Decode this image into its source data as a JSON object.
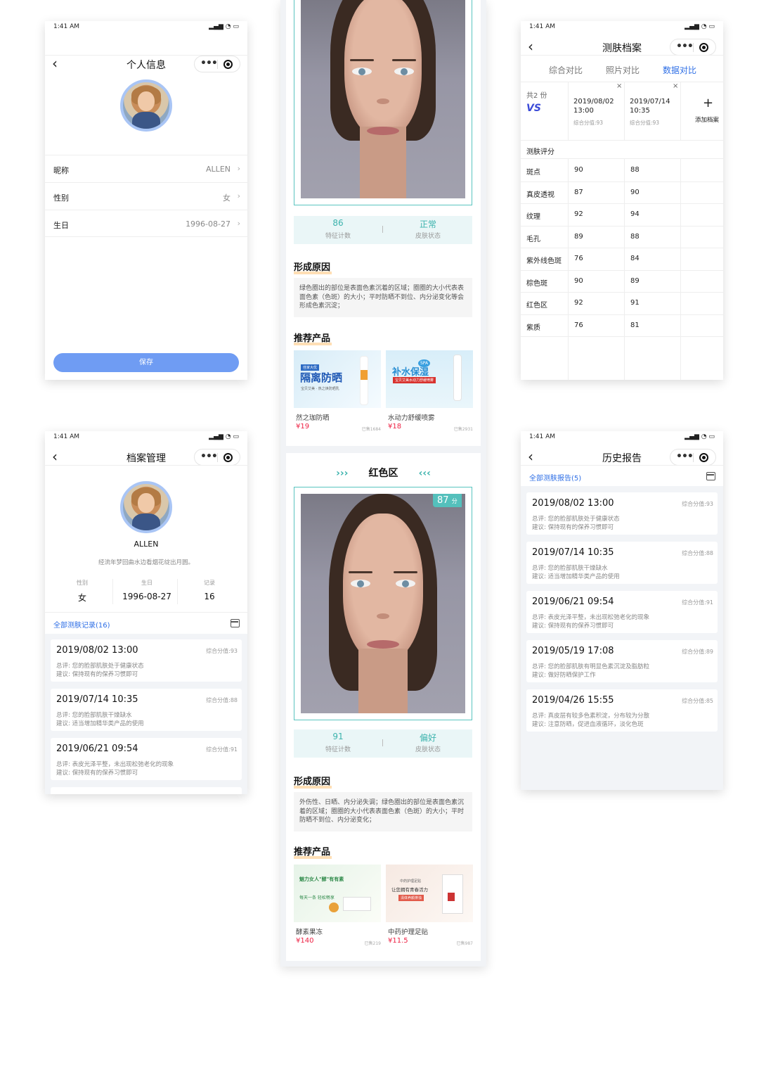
{
  "status_time": "1:41 AM",
  "status_signal": "▂▄▆ ◔ ▭",
  "back_glyph": "‹",
  "capsule_dots": "•••",
  "profile": {
    "title": "个人信息",
    "rows": [
      {
        "label": "昵称",
        "value": "ALLEN"
      },
      {
        "label": "性别",
        "value": "女"
      },
      {
        "label": "生日",
        "value": "1996-08-27"
      }
    ],
    "save_label": "保存"
  },
  "archive_mgmt": {
    "title": "档案管理",
    "name": "ALLEN",
    "motto": "经流年梦回曲水边看烟花绽出月圆。",
    "stats": [
      {
        "label": "性别",
        "value": "女"
      },
      {
        "label": "生日",
        "value": "1996-08-27"
      },
      {
        "label": "记录",
        "value": "16"
      }
    ],
    "records_link": "全部测肤记录(16)",
    "records": [
      {
        "date": "2019/08/02 13:00",
        "score": "综合分值:93",
        "summary": "总评: 您的脸部肌肤处于健康状态",
        "advice": "建议: 保持现有的保养习惯即可"
      },
      {
        "date": "2019/07/14 10:35",
        "score": "综合分值:88",
        "summary": "总评: 您的脸部肌肤干燥缺水",
        "advice": "建议: 适当增加精华类产品的使用"
      },
      {
        "date": "2019/06/21 09:54",
        "score": "综合分值:91",
        "summary": "总评: 表皮光泽平整，未出现松弛老化的现象",
        "advice": "建议: 保持现有的保养习惯即可"
      }
    ]
  },
  "analysis": {
    "top": {
      "count": "86",
      "count_label": "特征计数",
      "state": "正常",
      "state_label": "皮肤状态",
      "reason_title": "形成原因",
      "reason": "绿色圈出的部位是表面色素沉着的区域；圈圈的大小代表表面色素（色斑）的大小；平时防晒不到位、内分泌变化等会形成色素沉淀；",
      "products_title": "推荐产品",
      "products": [
        {
          "name": "然之珈防晒",
          "price": "¥19",
          "sold": "已售1684",
          "banner": "隔离防晒",
          "tag": "佳家大优",
          "sub": "宝贝艾美 · 热之焕防晒乳"
        },
        {
          "name": "水动力舒缓喷雾",
          "price": "¥18",
          "sold": "已售2931",
          "banner": "补水保湿",
          "tag": "SPA",
          "sub": "宝贝艾美水动力舒缓喷雾"
        }
      ]
    },
    "bottom": {
      "region": "红色区",
      "arrows_left": "›››",
      "arrows_right": "‹‹‹",
      "score": "87",
      "score_unit": "分",
      "count": "91",
      "count_label": "特征计数",
      "state": "偏好",
      "state_label": "皮肤状态",
      "reason_title": "形成原因",
      "reason": "外伤性、日晒、内分泌失调；绿色圈出的部位是表面色素沉着的区域；圈圈的大小代表表面色素（色斑）的大小；平时防晒不到位、内分泌变化；",
      "products_title": "推荐产品",
      "products": [
        {
          "name": "酵素果冻",
          "price": "¥140",
          "sold": "已售219",
          "banner": "魅力女人\"酵\"有有素",
          "sub": "每天一条 轻松畅享"
        },
        {
          "name": "中药护理足贴",
          "price": "¥11.5",
          "sold": "已售987",
          "banner": "让您拥有青春活力",
          "sub": "中药护理足贴",
          "tag": "清体养颜排浊"
        }
      ]
    }
  },
  "skin_archive": {
    "title": "测肤档案",
    "tabs": [
      "综合对比",
      "照片对比",
      "数据对比"
    ],
    "active_tab": 2,
    "count_label": "共2 份",
    "vs": "VS",
    "close_glyph": "×",
    "add_glyph": "+",
    "add_label": "添加档案",
    "reports": [
      {
        "date": "2019/08/02",
        "time": "13:00",
        "score": "综合分值:93"
      },
      {
        "date": "2019/07/14",
        "time": "10:35",
        "score": "综合分值:93"
      }
    ],
    "section": "测肤评分",
    "metrics": [
      {
        "name": "斑点",
        "a": "90",
        "b": "88"
      },
      {
        "name": "真皮透视",
        "a": "87",
        "b": "90"
      },
      {
        "name": "纹理",
        "a": "92",
        "b": "94"
      },
      {
        "name": "毛孔",
        "a": "89",
        "b": "88"
      },
      {
        "name": "紫外线色斑",
        "a": "76",
        "b": "84"
      },
      {
        "name": "棕色斑",
        "a": "90",
        "b": "89"
      },
      {
        "name": "红色区",
        "a": "92",
        "b": "91"
      },
      {
        "name": "紫质",
        "a": "76",
        "b": "81"
      }
    ]
  },
  "history": {
    "title": "历史报告",
    "link": "全部测肤报告(5)",
    "items": [
      {
        "date": "2019/08/02 13:00",
        "score": "综合分值:93",
        "summary": "总评: 您的脸部肌肤处于健康状态",
        "advice": "建议: 保持现有的保养习惯即可"
      },
      {
        "date": "2019/07/14 10:35",
        "score": "综合分值:88",
        "summary": "总评: 您的脸部肌肤干燥缺水",
        "advice": "建议: 适当增加精华类产品的使用"
      },
      {
        "date": "2019/06/21 09:54",
        "score": "综合分值:91",
        "summary": "总评: 表皮光泽平整，未出现松弛老化的现象",
        "advice": "建议: 保持现有的保养习惯即可"
      },
      {
        "date": "2019/05/19 17:08",
        "score": "综合分值:89",
        "summary": "总评: 您的脸部肌肤有明显色素沉淀及脂肪粒",
        "advice": "建议: 做好防晒保护工作"
      },
      {
        "date": "2019/04/26 15:55",
        "score": "综合分值:85",
        "summary": "总评: 真皮层有较多色素积淀，分布较为分散",
        "advice": "建议: 注意防晒，促进血液循环，淡化色斑"
      }
    ]
  },
  "colors": {
    "accent": "#2f6fe6",
    "teal": "#3cb3ad",
    "button": "#6f9cf3",
    "price": "#ee2244"
  }
}
